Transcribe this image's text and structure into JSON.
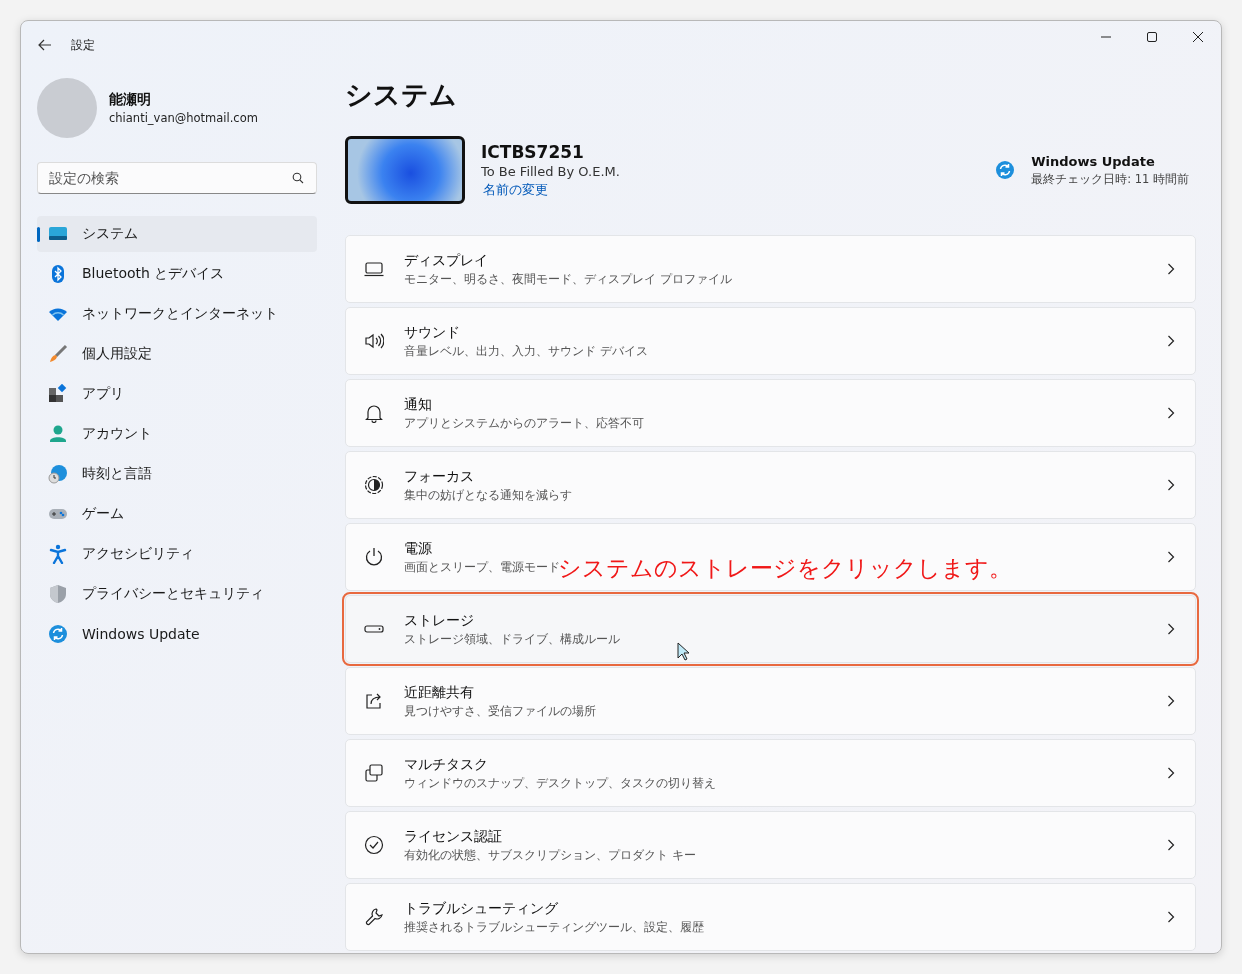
{
  "window": {
    "title": "設定"
  },
  "user": {
    "name": "能瀬明",
    "email": "chianti_van@hotmail.com"
  },
  "search": {
    "placeholder": "設定の検索"
  },
  "sidebar": {
    "items": [
      {
        "label": "システム",
        "kind": "system",
        "selected": true
      },
      {
        "label": "Bluetooth とデバイス",
        "kind": "bluetooth",
        "selected": false
      },
      {
        "label": "ネットワークとインターネット",
        "kind": "wifi",
        "selected": false
      },
      {
        "label": "個人用設定",
        "kind": "brush",
        "selected": false
      },
      {
        "label": "アプリ",
        "kind": "apps",
        "selected": false
      },
      {
        "label": "アカウント",
        "kind": "account",
        "selected": false
      },
      {
        "label": "時刻と言語",
        "kind": "time",
        "selected": false
      },
      {
        "label": "ゲーム",
        "kind": "game",
        "selected": false
      },
      {
        "label": "アクセシビリティ",
        "kind": "accessibility",
        "selected": false
      },
      {
        "label": "プライバシーとセキュリティ",
        "kind": "shield",
        "selected": false
      },
      {
        "label": "Windows Update",
        "kind": "update",
        "selected": false
      }
    ]
  },
  "page_title": "システム",
  "device": {
    "name": "ICTBS7251",
    "manufacturer": "To Be Filled By O.E.M.",
    "rename_link": "名前の変更"
  },
  "update": {
    "title": "Windows Update",
    "status": "最終チェック日時: 11 時間前"
  },
  "settings": [
    {
      "kind": "display",
      "title": "ディスプレイ",
      "subtitle": "モニター、明るさ、夜間モード、ディスプレイ プロファイル",
      "highlighted": false
    },
    {
      "kind": "sound",
      "title": "サウンド",
      "subtitle": "音量レベル、出力、入力、サウンド デバイス",
      "highlighted": false
    },
    {
      "kind": "bell",
      "title": "通知",
      "subtitle": "アプリとシステムからのアラート、応答不可",
      "highlighted": false
    },
    {
      "kind": "focus",
      "title": "フォーカス",
      "subtitle": "集中の妨げとなる通知を減らす",
      "highlighted": false
    },
    {
      "kind": "power",
      "title": "電源",
      "subtitle": "画面とスリープ、電源モード",
      "highlighted": false
    },
    {
      "kind": "storage",
      "title": "ストレージ",
      "subtitle": "ストレージ領域、ドライブ、構成ルール",
      "highlighted": true
    },
    {
      "kind": "share",
      "title": "近距離共有",
      "subtitle": "見つけやすさ、受信ファイルの場所",
      "highlighted": false
    },
    {
      "kind": "multitask",
      "title": "マルチタスク",
      "subtitle": "ウィンドウのスナップ、デスクトップ、タスクの切り替え",
      "highlighted": false
    },
    {
      "kind": "check",
      "title": "ライセンス認証",
      "subtitle": "有効化の状態、サブスクリプション、プロダクト キー",
      "highlighted": false
    },
    {
      "kind": "wrench",
      "title": "トラブルシューティング",
      "subtitle": "推奨されるトラブルシューティングツール、設定、履歴",
      "highlighted": false
    }
  ],
  "annotation": {
    "text": "システムのストレージをクリックします。"
  }
}
